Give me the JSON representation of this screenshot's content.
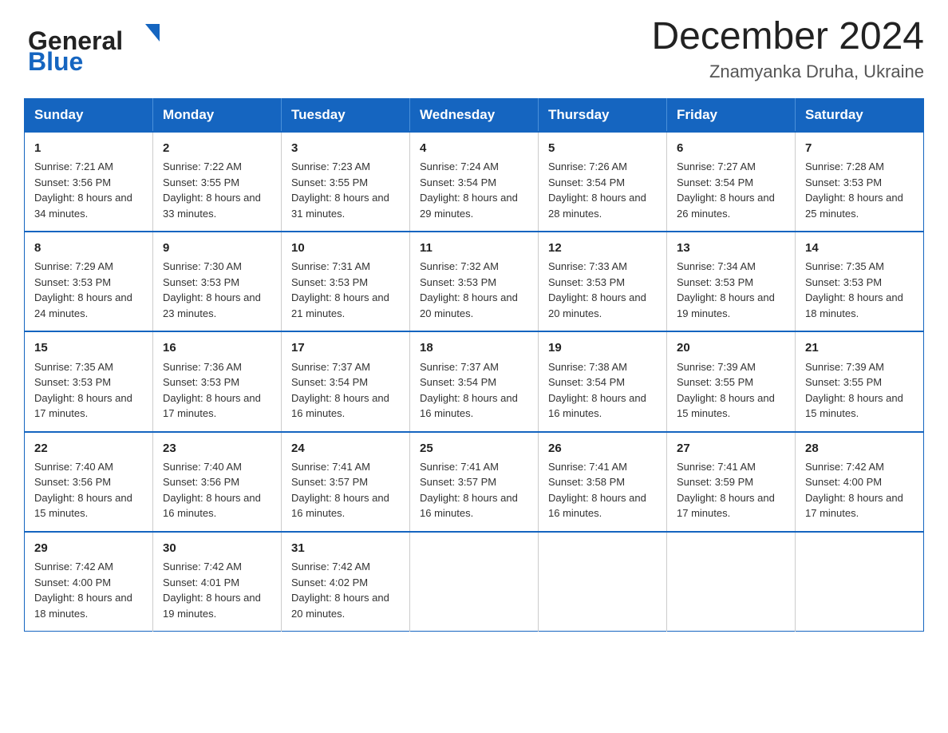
{
  "header": {
    "logo": {
      "general": "General",
      "blue": "Blue",
      "triangle_char": "▲"
    },
    "title": "December 2024",
    "location": "Znamyanka Druha, Ukraine"
  },
  "calendar": {
    "days_of_week": [
      "Sunday",
      "Monday",
      "Tuesday",
      "Wednesday",
      "Thursday",
      "Friday",
      "Saturday"
    ],
    "weeks": [
      [
        {
          "day": "1",
          "sunrise": "7:21 AM",
          "sunset": "3:56 PM",
          "daylight": "8 hours and 34 minutes."
        },
        {
          "day": "2",
          "sunrise": "7:22 AM",
          "sunset": "3:55 PM",
          "daylight": "8 hours and 33 minutes."
        },
        {
          "day": "3",
          "sunrise": "7:23 AM",
          "sunset": "3:55 PM",
          "daylight": "8 hours and 31 minutes."
        },
        {
          "day": "4",
          "sunrise": "7:24 AM",
          "sunset": "3:54 PM",
          "daylight": "8 hours and 29 minutes."
        },
        {
          "day": "5",
          "sunrise": "7:26 AM",
          "sunset": "3:54 PM",
          "daylight": "8 hours and 28 minutes."
        },
        {
          "day": "6",
          "sunrise": "7:27 AM",
          "sunset": "3:54 PM",
          "daylight": "8 hours and 26 minutes."
        },
        {
          "day": "7",
          "sunrise": "7:28 AM",
          "sunset": "3:53 PM",
          "daylight": "8 hours and 25 minutes."
        }
      ],
      [
        {
          "day": "8",
          "sunrise": "7:29 AM",
          "sunset": "3:53 PM",
          "daylight": "8 hours and 24 minutes."
        },
        {
          "day": "9",
          "sunrise": "7:30 AM",
          "sunset": "3:53 PM",
          "daylight": "8 hours and 23 minutes."
        },
        {
          "day": "10",
          "sunrise": "7:31 AM",
          "sunset": "3:53 PM",
          "daylight": "8 hours and 21 minutes."
        },
        {
          "day": "11",
          "sunrise": "7:32 AM",
          "sunset": "3:53 PM",
          "daylight": "8 hours and 20 minutes."
        },
        {
          "day": "12",
          "sunrise": "7:33 AM",
          "sunset": "3:53 PM",
          "daylight": "8 hours and 20 minutes."
        },
        {
          "day": "13",
          "sunrise": "7:34 AM",
          "sunset": "3:53 PM",
          "daylight": "8 hours and 19 minutes."
        },
        {
          "day": "14",
          "sunrise": "7:35 AM",
          "sunset": "3:53 PM",
          "daylight": "8 hours and 18 minutes."
        }
      ],
      [
        {
          "day": "15",
          "sunrise": "7:35 AM",
          "sunset": "3:53 PM",
          "daylight": "8 hours and 17 minutes."
        },
        {
          "day": "16",
          "sunrise": "7:36 AM",
          "sunset": "3:53 PM",
          "daylight": "8 hours and 17 minutes."
        },
        {
          "day": "17",
          "sunrise": "7:37 AM",
          "sunset": "3:54 PM",
          "daylight": "8 hours and 16 minutes."
        },
        {
          "day": "18",
          "sunrise": "7:37 AM",
          "sunset": "3:54 PM",
          "daylight": "8 hours and 16 minutes."
        },
        {
          "day": "19",
          "sunrise": "7:38 AM",
          "sunset": "3:54 PM",
          "daylight": "8 hours and 16 minutes."
        },
        {
          "day": "20",
          "sunrise": "7:39 AM",
          "sunset": "3:55 PM",
          "daylight": "8 hours and 15 minutes."
        },
        {
          "day": "21",
          "sunrise": "7:39 AM",
          "sunset": "3:55 PM",
          "daylight": "8 hours and 15 minutes."
        }
      ],
      [
        {
          "day": "22",
          "sunrise": "7:40 AM",
          "sunset": "3:56 PM",
          "daylight": "8 hours and 15 minutes."
        },
        {
          "day": "23",
          "sunrise": "7:40 AM",
          "sunset": "3:56 PM",
          "daylight": "8 hours and 16 minutes."
        },
        {
          "day": "24",
          "sunrise": "7:41 AM",
          "sunset": "3:57 PM",
          "daylight": "8 hours and 16 minutes."
        },
        {
          "day": "25",
          "sunrise": "7:41 AM",
          "sunset": "3:57 PM",
          "daylight": "8 hours and 16 minutes."
        },
        {
          "day": "26",
          "sunrise": "7:41 AM",
          "sunset": "3:58 PM",
          "daylight": "8 hours and 16 minutes."
        },
        {
          "day": "27",
          "sunrise": "7:41 AM",
          "sunset": "3:59 PM",
          "daylight": "8 hours and 17 minutes."
        },
        {
          "day": "28",
          "sunrise": "7:42 AM",
          "sunset": "4:00 PM",
          "daylight": "8 hours and 17 minutes."
        }
      ],
      [
        {
          "day": "29",
          "sunrise": "7:42 AM",
          "sunset": "4:00 PM",
          "daylight": "8 hours and 18 minutes."
        },
        {
          "day": "30",
          "sunrise": "7:42 AM",
          "sunset": "4:01 PM",
          "daylight": "8 hours and 19 minutes."
        },
        {
          "day": "31",
          "sunrise": "7:42 AM",
          "sunset": "4:02 PM",
          "daylight": "8 hours and 20 minutes."
        },
        null,
        null,
        null,
        null
      ]
    ]
  }
}
